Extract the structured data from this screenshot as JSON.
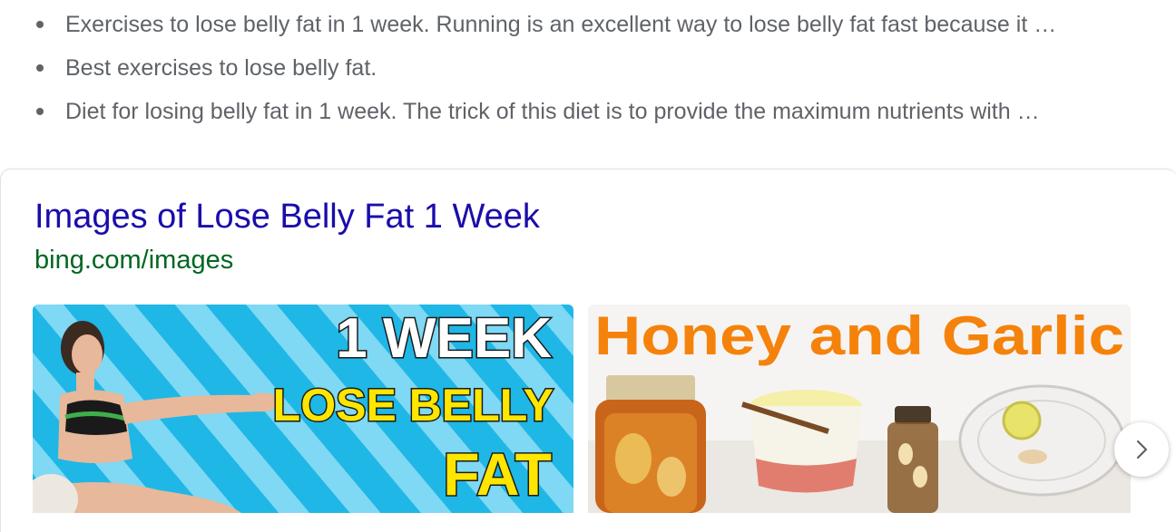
{
  "bullets": [
    "Exercises to lose belly fat in 1 week. Running is an excellent way to lose belly fat fast because it …",
    "Best exercises to lose belly fat.",
    "Diet for losing belly fat in 1 week. The trick of this diet is to provide the maximum nutrients with …"
  ],
  "images_card": {
    "title": "Images of Lose Belly Fat 1 Week",
    "url": "bing.com/images",
    "thumbnails": [
      {
        "lines": [
          "1 WEEK",
          "LOSE BELLY",
          "FAT"
        ],
        "background": "#1fb7e6",
        "stripe": "#6dd3f2",
        "text_color": "#ffe600"
      },
      {
        "lines": [
          "Honey and Garlic"
        ],
        "text_color": "#f5820a"
      }
    ],
    "next_icon": "chevron-right-icon"
  },
  "colors": {
    "link": "#1a0dab",
    "url": "#006621",
    "text": "#5f6368"
  }
}
